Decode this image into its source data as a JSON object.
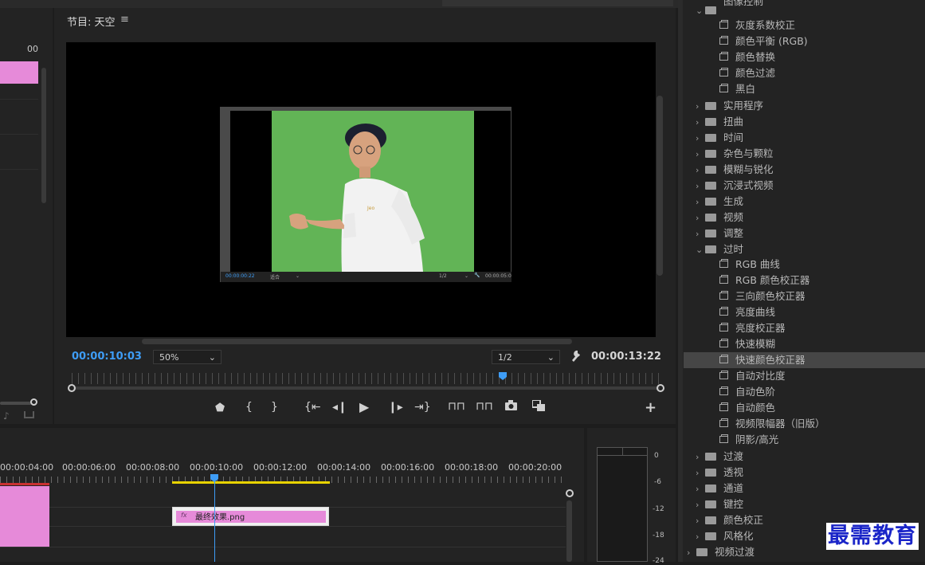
{
  "program_monitor": {
    "title": "节目: 天空",
    "menu_icon": "≡",
    "current_time": "00:00:10:03",
    "zoom": "50%",
    "resolution": "1/2",
    "duration": "00:00:13:22",
    "wrench_icon": "wrench-icon",
    "nested_preview": {
      "time": "00:00:00:22",
      "zoom": "适合",
      "resolution": "1/2",
      "duration": "00:00:05:0"
    }
  },
  "source_panel": {
    "timecode_fragment": "00"
  },
  "transport": {
    "controls": [
      "marker",
      "mark-in",
      "mark-out",
      "go-to-in",
      "step-back",
      "play",
      "step-forward",
      "go-to-out",
      "lift",
      "extract",
      "export-frame",
      "compare",
      "add"
    ]
  },
  "timeline": {
    "ruler": [
      "00:00:04:00",
      "00:00:06:00",
      "00:00:08:00",
      "00:00:10:00",
      "00:00:12:00",
      "00:00:14:00",
      "00:00:16:00",
      "00:00:18:00",
      "00:00:20:00"
    ],
    "clip": {
      "fx": "fx",
      "name": "最终效果.png"
    }
  },
  "audio_meter": {
    "ticks": [
      "0",
      "-6",
      "-12",
      "-18",
      "-24"
    ]
  },
  "effects_tree": {
    "top_partial": "图像控制",
    "image_control_items": [
      "灰度系数校正",
      "颜色平衡 (RGB)",
      "颜色替换",
      "颜色过滤",
      "黑白"
    ],
    "folders_a": [
      "实用程序",
      "扭曲",
      "时间",
      "杂色与颗粒",
      "模糊与锐化",
      "沉浸式视频",
      "生成",
      "视频",
      "调整"
    ],
    "obsolete_folder": "过时",
    "obsolete_items": [
      "RGB 曲线",
      "RGB 颜色校正器",
      "三向颜色校正器",
      "亮度曲线",
      "亮度校正器",
      "快速模糊",
      "快速颜色校正器",
      "自动对比度",
      "自动色阶",
      "自动颜色",
      "视频限幅器（旧版）",
      "阴影/高光"
    ],
    "selected_item": "快速颜色校正器",
    "folders_b": [
      "过渡",
      "透视",
      "通道",
      "键控",
      "颜色校正",
      "风格化"
    ],
    "root_folder": "视频过渡"
  },
  "watermark": "最需教育",
  "colors": {
    "accent_blue": "#3e9df6",
    "clip_pink": "#e68ad9",
    "green_screen": "#62b456",
    "panel_bg": "#232323",
    "selected_row": "#464646",
    "work_area_yellow": "#e8d200",
    "watermark_blue": "#1a25c8"
  }
}
